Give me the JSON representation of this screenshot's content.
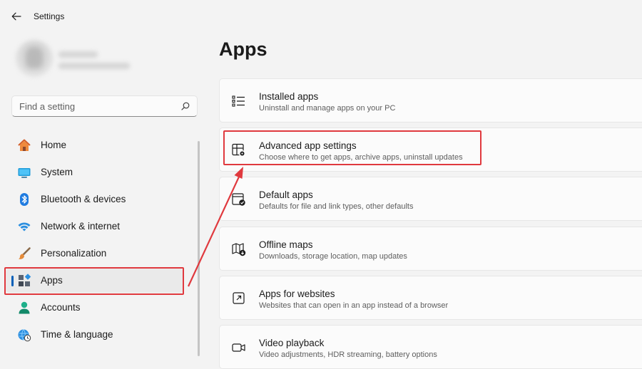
{
  "window": {
    "title": "Settings"
  },
  "search": {
    "placeholder": "Find a setting"
  },
  "nav": {
    "items": [
      {
        "label": "Home"
      },
      {
        "label": "System"
      },
      {
        "label": "Bluetooth & devices"
      },
      {
        "label": "Network & internet"
      },
      {
        "label": "Personalization"
      },
      {
        "label": "Apps"
      },
      {
        "label": "Accounts"
      },
      {
        "label": "Time & language"
      }
    ],
    "selected": "Apps"
  },
  "main": {
    "title": "Apps",
    "cards": [
      {
        "title": "Installed apps",
        "desc": "Uninstall and manage apps on your PC"
      },
      {
        "title": "Advanced app settings",
        "desc": "Choose where to get apps, archive apps, uninstall updates"
      },
      {
        "title": "Default apps",
        "desc": "Defaults for file and link types, other defaults"
      },
      {
        "title": "Offline maps",
        "desc": "Downloads, storage location, map updates"
      },
      {
        "title": "Apps for websites",
        "desc": "Websites that can open in an app instead of a browser"
      },
      {
        "title": "Video playback",
        "desc": "Video adjustments, HDR streaming, battery options"
      }
    ]
  },
  "colors": {
    "accent": "#005fb8",
    "annotation": "#e0393e"
  }
}
